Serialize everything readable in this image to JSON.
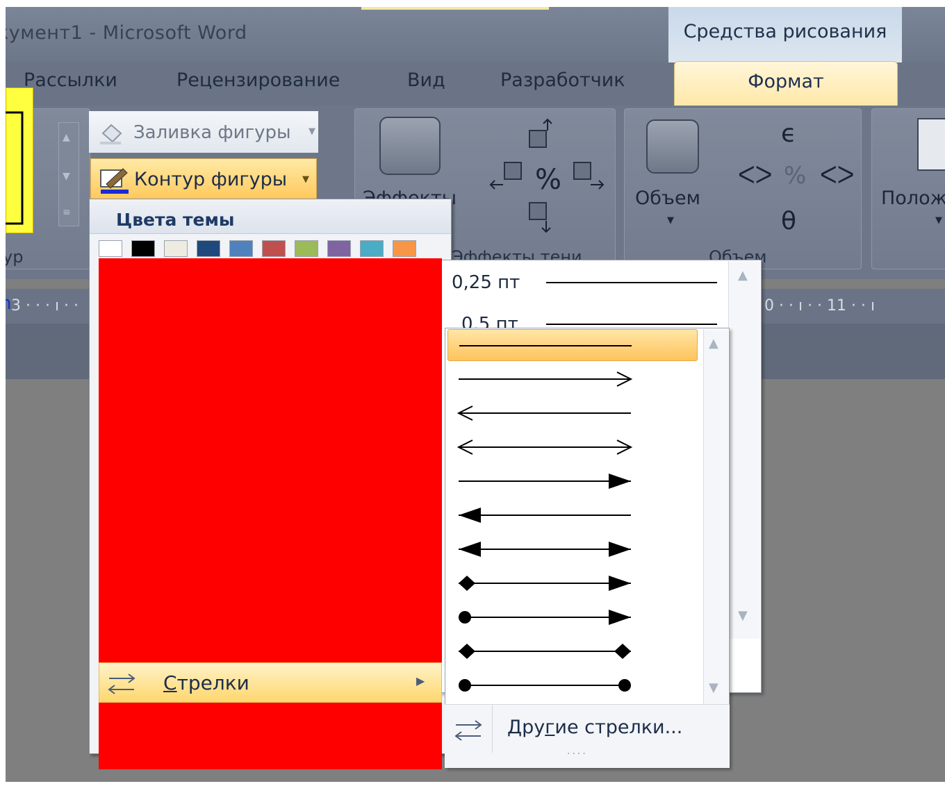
{
  "window": {
    "title": "кумент1 - Microsoft Word",
    "tools_context": "Средства рисования"
  },
  "tabs": [
    "Рассылки",
    "Рецензирование",
    "Вид",
    "Разработчик"
  ],
  "active_tab": "Формат",
  "ribbon": {
    "fill_label": "Заливка фигуры",
    "contour_label": "Контур фигуры",
    "effects_label": "Эффекты",
    "shadow_group": "Эффекты тени",
    "volume_label": "Объем",
    "volume_group": "Объем",
    "position_label": "Полож",
    "left_group": "ур"
  },
  "ruler": {
    "left_marks": "3 · · · ı · ·",
    "right_marks": "0 · · ı · · 11 · · ı"
  },
  "contour_menu": {
    "header": "Цвета темы",
    "swatches": [
      "#ffffff",
      "#000000",
      "#eeece1",
      "#1f497d",
      "#4f81bd",
      "#c0504d",
      "#9bbb59",
      "#8064a2",
      "#4bacc6",
      "#f79646"
    ],
    "arrows_item_prefix": "С",
    "arrows_item_rest": "трелки"
  },
  "width_menu": {
    "items": [
      "0,25 пт",
      "0,5 пт"
    ]
  },
  "arrows_menu": {
    "styles": [
      "line",
      "arrow-right",
      "arrow-left",
      "arrow-both",
      "triangle-right",
      "triangle-left",
      "triangle-both",
      "diamond-triangle",
      "oval-triangle",
      "diamond-diamond",
      "oval-oval"
    ],
    "selected_index": 0,
    "more_label_a": "Дру",
    "more_label_u": "г",
    "more_label_b": "ие стрелки..."
  },
  "colors": {
    "highlight": "#ffd66e",
    "redaction": "#ff0000"
  }
}
